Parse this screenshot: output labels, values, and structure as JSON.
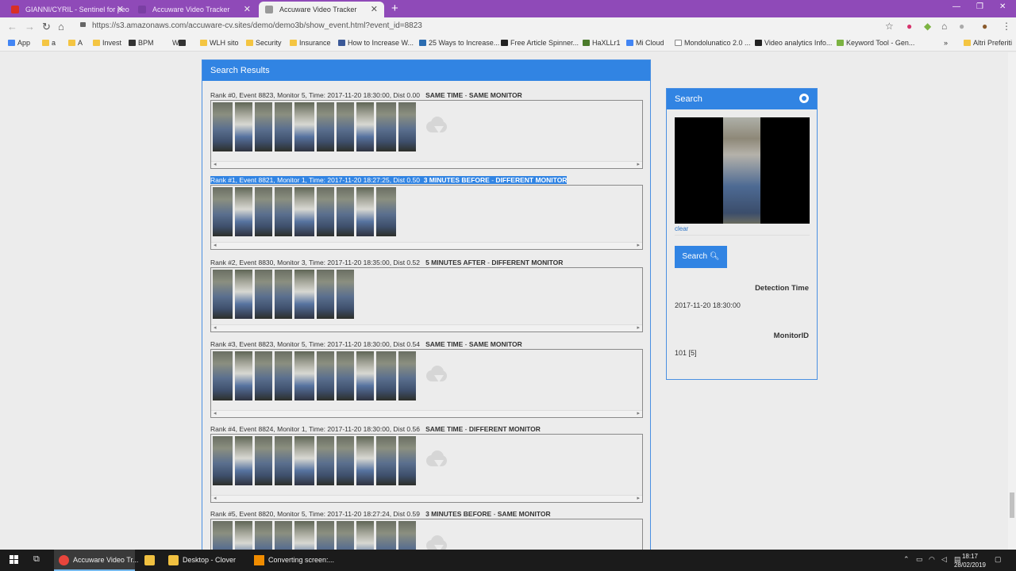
{
  "browser": {
    "tabs": [
      {
        "label": "GIANNI/CYRIL - Sentinel for peo",
        "favicon_color": "#d93025"
      },
      {
        "label": "Accuware Video Tracker",
        "favicon_color": "#7a3fa3"
      },
      {
        "label": "Accuware Video Tracker",
        "favicon_color": "#999999",
        "active": true
      }
    ],
    "url": "https://s3.amazonaws.com/accuware-cv.sites/demo/demo3b/show_event.html?event_id=8823",
    "bookmarks": [
      "App",
      "a",
      "A",
      "Invest",
      "BPM",
      "W",
      "",
      "WLH sito",
      "Security",
      "Insurance",
      "How to Increase W...",
      "25 Ways to Increase...",
      "Free Article Spinner...",
      "HaXLLr1",
      "Mi Cloud",
      "Mondolunatico 2.0 ...",
      "Video analytics Info...",
      "Keyword Tool - Gen...",
      "Altri Preferiti"
    ]
  },
  "results_panel": {
    "title": "Search Results",
    "results": [
      {
        "meta": "Rank #0, Event 8823, Monitor 5, Time: 2017-11-20 18:30:00, Dist 0.00",
        "tag_time": "SAME TIME",
        "tag_sep": " - ",
        "tag_monitor": "SAME MONITOR",
        "thumb_count": 10,
        "cloud": true
      },
      {
        "meta": "Rank #1, Event 8821, Monitor 1, Time: 2017-11-20 18:27:25, Dist 0.50",
        "tag_time": "3 MINUTES BEFORE",
        "tag_sep": " - ",
        "tag_monitor": "DIFFERENT MONITOR",
        "thumb_count": 9,
        "cloud": false,
        "selected": true
      },
      {
        "meta": "Rank #2, Event 8830, Monitor 3, Time: 2017-11-20 18:35:00, Dist 0.52",
        "tag_time": "5 MINUTES AFTER",
        "tag_sep": " - ",
        "tag_monitor": "DIFFERENT MONITOR",
        "thumb_count": 7,
        "cloud": false
      },
      {
        "meta": "Rank #3, Event 8823, Monitor 5, Time: 2017-11-20 18:30:00, Dist 0.54",
        "tag_time": "SAME TIME",
        "tag_sep": " - ",
        "tag_monitor": "SAME MONITOR",
        "thumb_count": 10,
        "cloud": true
      },
      {
        "meta": "Rank #4, Event 8824, Monitor 1, Time: 2017-11-20 18:30:00, Dist 0.56",
        "tag_time": "SAME TIME",
        "tag_sep": " - ",
        "tag_monitor": "DIFFERENT MONITOR",
        "thumb_count": 10,
        "cloud": true
      },
      {
        "meta": "Rank #5, Event 8820, Monitor 5, Time: 2017-11-20 18:27:24, Dist 0.59",
        "tag_time": "3 MINUTES BEFORE",
        "tag_sep": " - ",
        "tag_monitor": "SAME MONITOR",
        "thumb_count": 10,
        "cloud": true
      }
    ]
  },
  "search_panel": {
    "title": "Search",
    "clear_label": "clear",
    "search_button": "Search",
    "detection_time_label": "Detection Time",
    "detection_time_value": "2017-11-20 18:30:00",
    "monitor_label": "MonitorID",
    "monitor_value": "101 [5]"
  },
  "taskbar": {
    "items": [
      {
        "label": "Accuware Video Tr...",
        "icon_color": "#e8453c",
        "active": true
      },
      {
        "label": "",
        "icon_color": "#f0c040"
      },
      {
        "label": "Desktop - Clover",
        "icon_color": "#f0c040"
      },
      {
        "label": "Converting screen:...",
        "icon_color": "#f08c00"
      }
    ],
    "time": "18:17",
    "date": "28/02/2019"
  },
  "colors": {
    "accent": "#3184e3",
    "tabbar": "#8f4ab8"
  }
}
